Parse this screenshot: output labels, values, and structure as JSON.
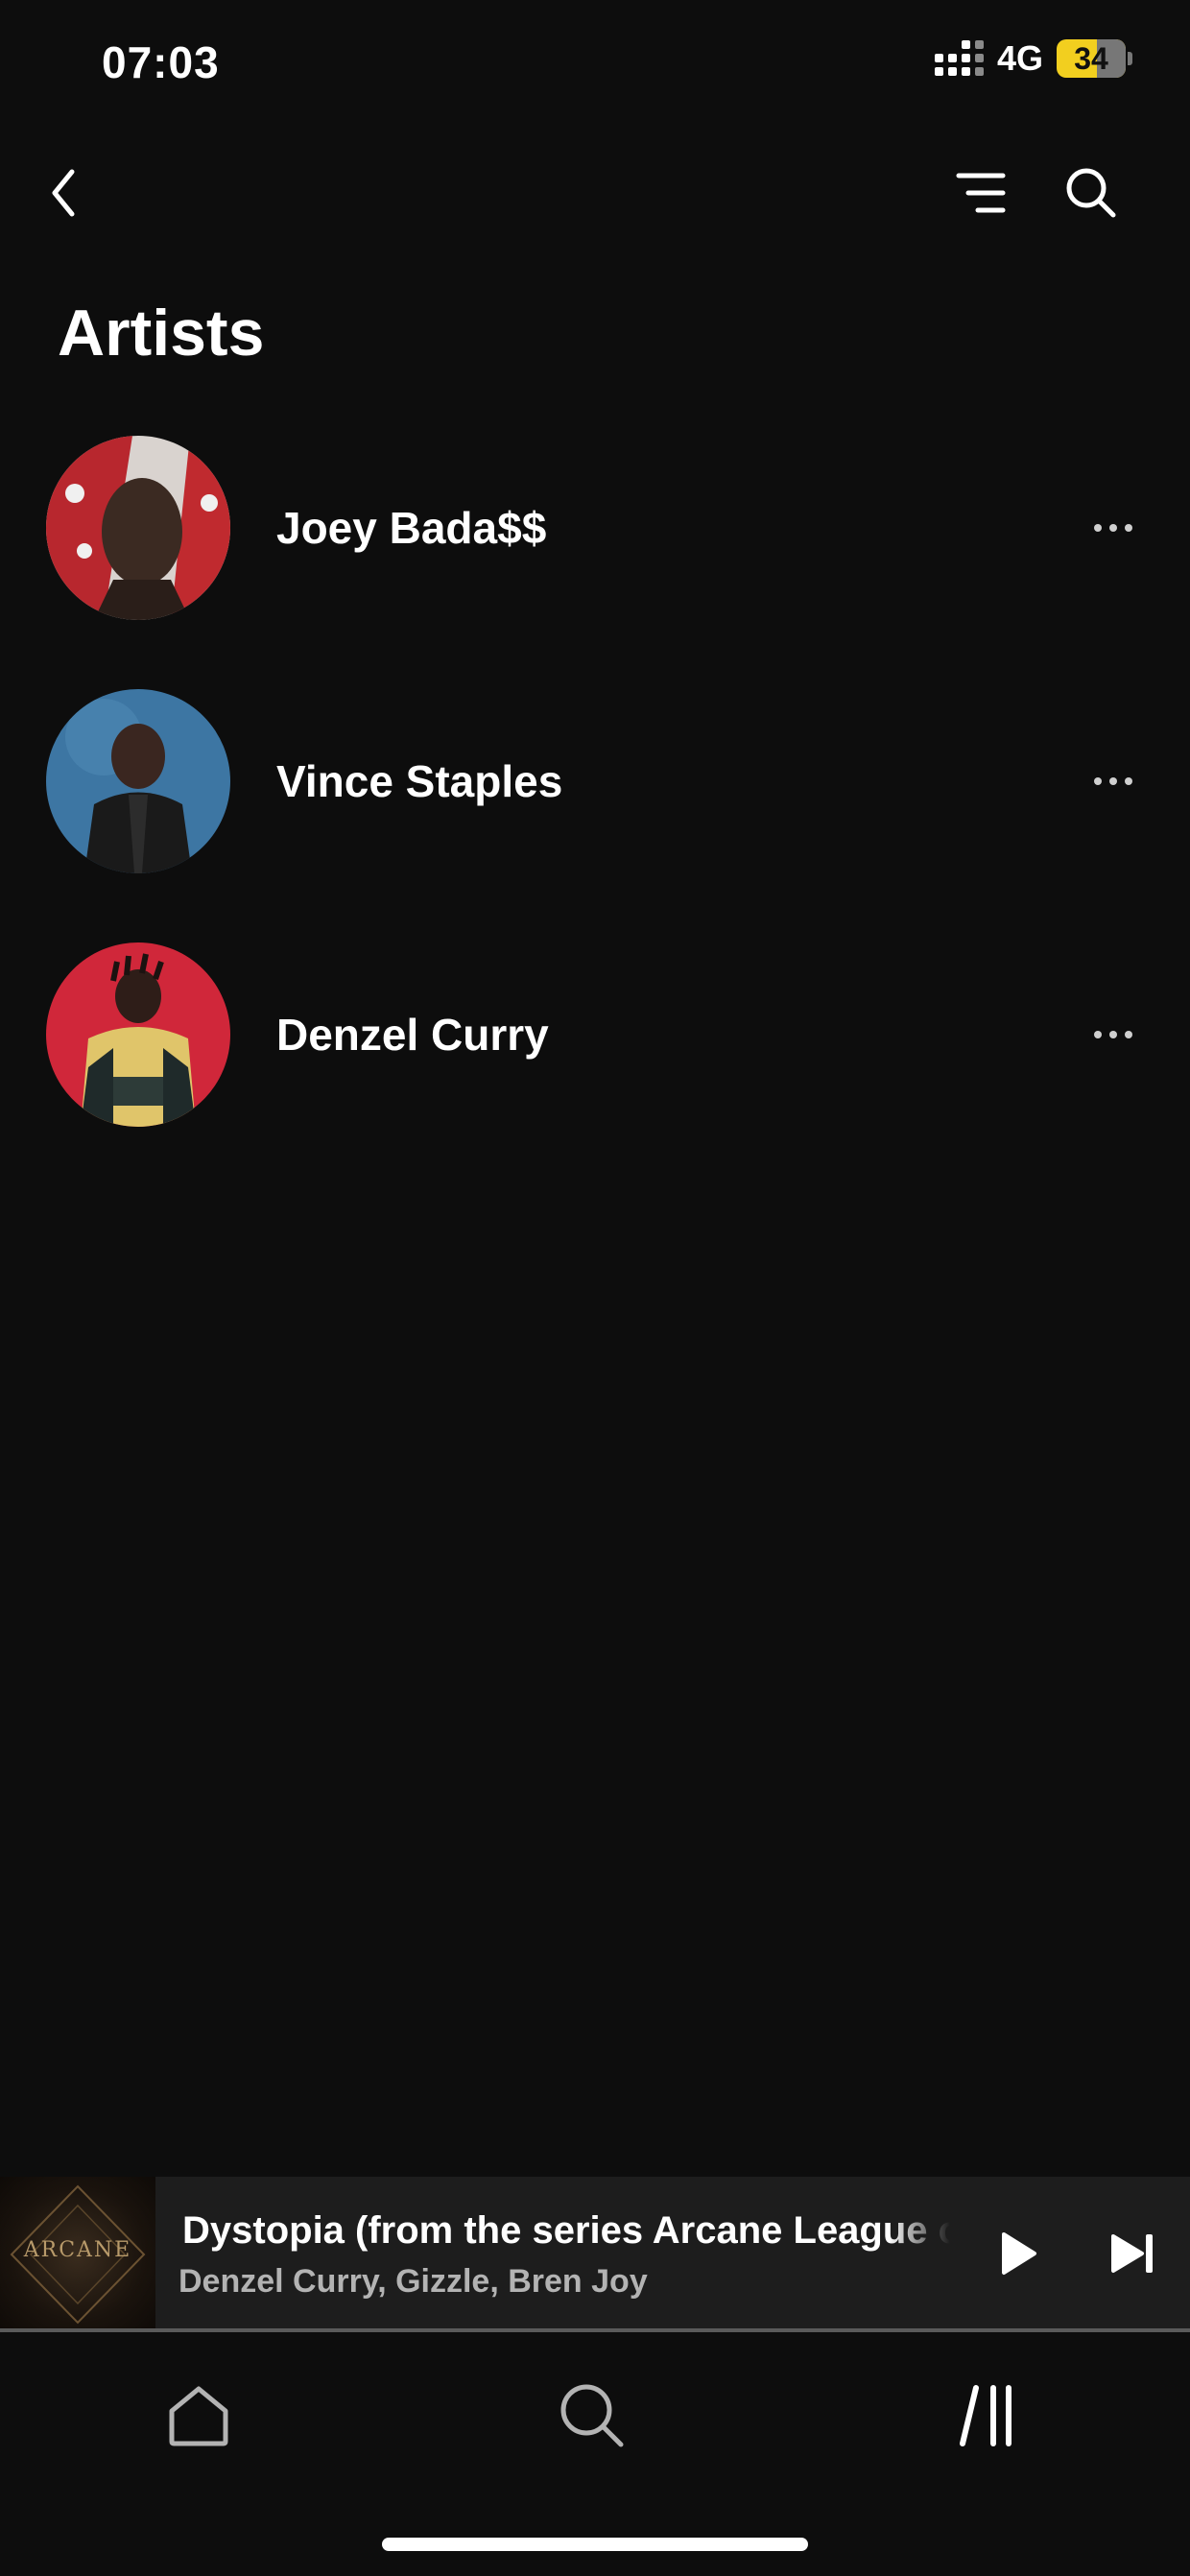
{
  "status_bar": {
    "time": "07:03",
    "network": "4G",
    "battery": "34",
    "battery_level": 0.34
  },
  "header": {
    "back_icon": "chevron-left-icon",
    "filter_icon": "sort-filter-icon",
    "search_icon": "search-icon"
  },
  "page": {
    "title": "Artists"
  },
  "artists": [
    {
      "name": "Joey Bada$$",
      "avatar_bg": "#c8c2c0"
    },
    {
      "name": "Vince Staples",
      "avatar_bg": "#3a6f9a"
    },
    {
      "name": "Denzel Curry",
      "avatar_bg": "#d0273a"
    }
  ],
  "mini_player": {
    "art_text": "ARCANE",
    "title": "Dystopia (from the series Arcane League of Legends)",
    "artist": "Denzel Curry, Gizzle, Bren Joy",
    "progress": 0.0
  },
  "bottom_nav": {
    "items": [
      {
        "icon": "home-icon"
      },
      {
        "icon": "search-icon"
      },
      {
        "icon": "library-icon"
      }
    ]
  },
  "colors": {
    "background": "#0d0d0d",
    "player_bg": "#1d1d1d",
    "battery_accent": "#f2cf1f"
  }
}
